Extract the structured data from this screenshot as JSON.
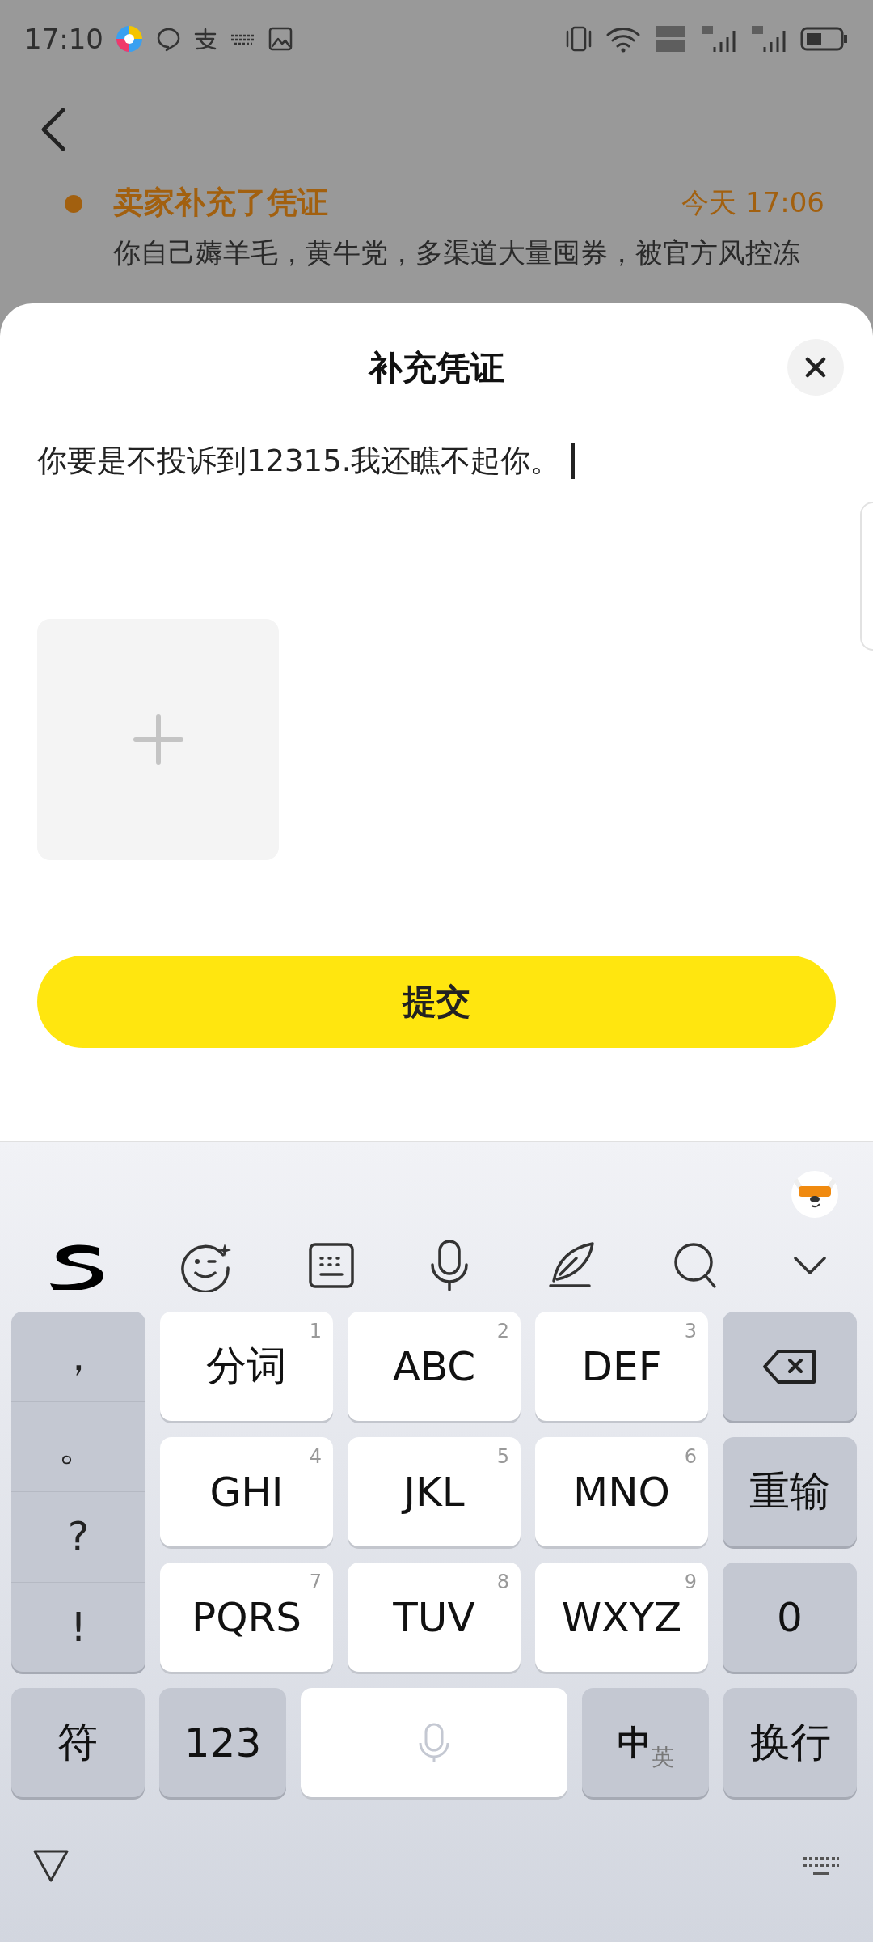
{
  "status_bar": {
    "time": "17:10"
  },
  "background": {
    "entry_title": "卖家补充了凭证",
    "entry_time": "今天 17:06",
    "entry_text": "你自己薅羊毛，黄牛党，多渠道大量囤券，被官方风控冻"
  },
  "sheet": {
    "title": "补充凭证",
    "input_value": "你要是不投诉到12315.我还瞧不起你。",
    "submit": "提交"
  },
  "keyboard": {
    "symbols": [
      "，",
      "。",
      "?",
      "!"
    ],
    "keys": [
      {
        "label": "分词",
        "digit": "1"
      },
      {
        "label": "ABC",
        "digit": "2"
      },
      {
        "label": "DEF",
        "digit": "3"
      },
      {
        "label": "GHI",
        "digit": "4"
      },
      {
        "label": "JKL",
        "digit": "5"
      },
      {
        "label": "MNO",
        "digit": "6"
      },
      {
        "label": "PQRS",
        "digit": "7"
      },
      {
        "label": "TUV",
        "digit": "8"
      },
      {
        "label": "WXYZ",
        "digit": "9"
      }
    ],
    "side_keys": [
      {
        "kind": "backspace"
      },
      {
        "kind": "text",
        "label": "重输"
      },
      {
        "kind": "text",
        "label": "0"
      }
    ],
    "bottom_keys": [
      {
        "kind": "text",
        "label": "符"
      },
      {
        "kind": "text",
        "label": "123"
      },
      {
        "kind": "space"
      },
      {
        "kind": "lang",
        "primary": "中",
        "secondary": "英"
      },
      {
        "kind": "text",
        "label": "换行"
      }
    ]
  }
}
